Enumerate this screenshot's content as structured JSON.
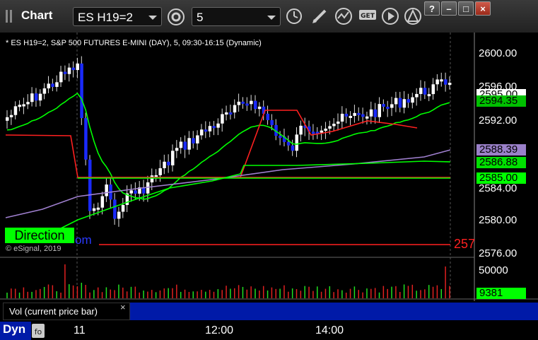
{
  "window": {
    "title": "Chart",
    "symbol": "ES H19=2",
    "interval": "5",
    "buttons": [
      "?",
      "–",
      "□",
      "×"
    ]
  },
  "chart": {
    "header": "* ES H19=2, S&P 500 FUTURES E-MINI (DAY), 5, 09:30-16:15 (Dynamic)",
    "watermark": "© eSignal, 2019",
    "direction_label": "Direction",
    "partial_label": "om",
    "red_cut_label": "257",
    "y_axis_labels": [
      "2600.00",
      "2596.00",
      "2592.00",
      "2584.00",
      "2580.00",
      "2576.00"
    ],
    "price_tags": [
      {
        "text": "2595.00",
        "bg": "#ffffff",
        "fg": "#000000"
      },
      {
        "text": "2594.35",
        "bg": "#00c000",
        "fg": "#000000"
      },
      {
        "text": "2588.39",
        "bg": "#9a80c8",
        "fg": "#000000"
      },
      {
        "text": "2586.88",
        "bg": "#00e000",
        "fg": "#000000"
      },
      {
        "text": "2585.00",
        "bg": "#00ff00",
        "fg": "#000000"
      }
    ],
    "x_axis_labels": [
      "11",
      "12:00",
      "14:00"
    ]
  },
  "volume": {
    "title": "Vol (current price bar)",
    "close_icon": "×",
    "axis_label": "50000",
    "current_tag": "9381"
  },
  "bottom": {
    "dyn_label": "Dyn"
  },
  "colors": {
    "up_candle": "#ffffff",
    "down_candle": "#1a2aff",
    "ma_green": "#00ff00",
    "ma_red": "#ff2020",
    "ma_purple": "#a080d0",
    "accent_blue": "#001aa8"
  }
}
